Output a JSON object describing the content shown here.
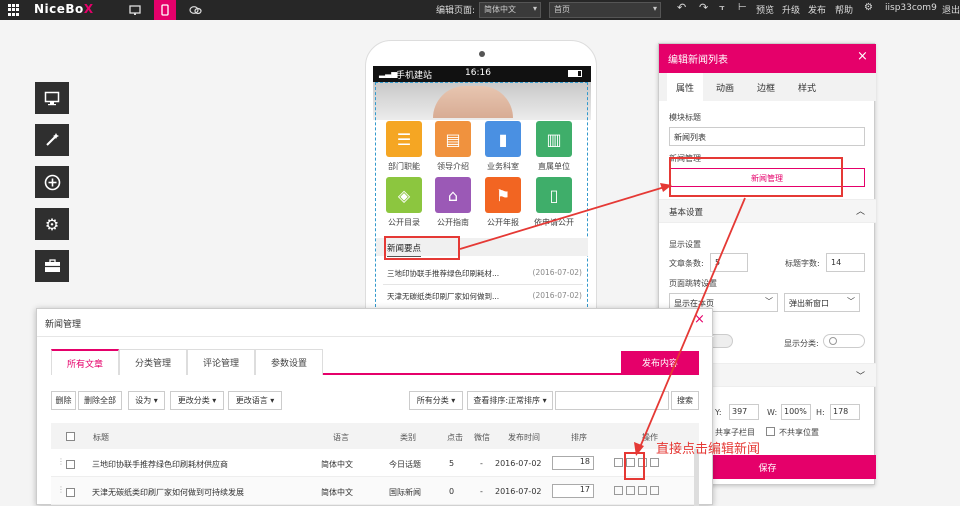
{
  "topbar": {
    "logo_a": "NiceBo",
    "logo_b": "X",
    "edit_page_label": "编辑页面:",
    "language_select": "简体中文",
    "page_select": "首页",
    "preview": "预览",
    "upgrade": "升级",
    "publish": "发布",
    "help": "帮助",
    "username": "iisp33com9",
    "logout": "退出"
  },
  "phone": {
    "carrier": "手机建站",
    "time": "16:16",
    "icons": [
      {
        "label": "部门职能",
        "color": "#f5a623",
        "icon": "list-icon"
      },
      {
        "label": "领导介绍",
        "color": "#f0923e",
        "icon": "document-icon"
      },
      {
        "label": "业务科室",
        "color": "#4a90e2",
        "icon": "file-icon"
      },
      {
        "label": "直属单位",
        "color": "#3fae6a",
        "icon": "building-icon"
      },
      {
        "label": "公开目录",
        "color": "#8cc63f",
        "icon": "layers-icon"
      },
      {
        "label": "公开指南",
        "color": "#9b59b6",
        "icon": "home-icon"
      },
      {
        "label": "公开年报",
        "color": "#f26522",
        "icon": "flag-icon"
      },
      {
        "label": "依申请公开",
        "color": "#3fae6a",
        "icon": "book-icon"
      }
    ],
    "news_heading": "新闻要点",
    "news": [
      {
        "title": "三地印协联手推荐绿色印刷耗材...",
        "date": "(2016-07-02)"
      },
      {
        "title": "天津无碳纸类印刷厂家如何做到...",
        "date": "(2016-07-02)"
      }
    ]
  },
  "edit_panel": {
    "title": "编辑新闻列表",
    "tabs": [
      "属性",
      "动画",
      "边框",
      "样式"
    ],
    "module_title_label": "模块标题",
    "module_title_value": "新闻列表",
    "news_mgmt_label": "新闻管理",
    "news_mgmt_button": "新闻管理",
    "basic_settings": "基本设置",
    "display_settings": "显示设置",
    "article_count_label": "文章条数:",
    "article_count": "5",
    "title_chars_label": "标题字数:",
    "title_chars": "14",
    "page_jump_label": "页面跳转设置",
    "jump_select": "显示在本页",
    "open_select": "弹出新窗口",
    "show_category_label": "显示分类:",
    "y_label": "Y:",
    "y_value": "397",
    "w_label": "W:",
    "w_value": "100%",
    "h_label": "H:",
    "h_value": "178",
    "share_a": "共享子栏目",
    "share_b": "不共享位置",
    "save": "保存"
  },
  "dialog": {
    "title": "新闻管理",
    "tabs": [
      "所有文章",
      "分类管理",
      "评论管理",
      "参数设置"
    ],
    "publish_btn": "发布内容",
    "toolbar": [
      "删除",
      "删除全部",
      "设为 ▾",
      "更改分类 ▾",
      "更改语言 ▾"
    ],
    "filter_all": "所有分类 ▾",
    "filter_sort": "查看排序:正常排序 ▾",
    "search_btn": "搜索",
    "columns": [
      "标题",
      "语言",
      "类别",
      "点击",
      "微信",
      "发布时间",
      "排序",
      "操作"
    ],
    "rows": [
      {
        "title": "三地印协联手推荐绿色印刷耗材供应商",
        "lang": "简体中文",
        "cat": "今日话题",
        "clicks": "5",
        "wechat": "-",
        "date": "2016-07-02",
        "order": "18"
      },
      {
        "title": "天津无碳纸类印刷厂家如何做到可持续发展",
        "lang": "简体中文",
        "cat": "国际新闻",
        "clicks": "0",
        "wechat": "-",
        "date": "2016-07-02",
        "order": "17"
      }
    ]
  },
  "annotation": "直接点击编辑新闻",
  "colors": {
    "accent": "#e5006a",
    "annot": "#e53935"
  }
}
